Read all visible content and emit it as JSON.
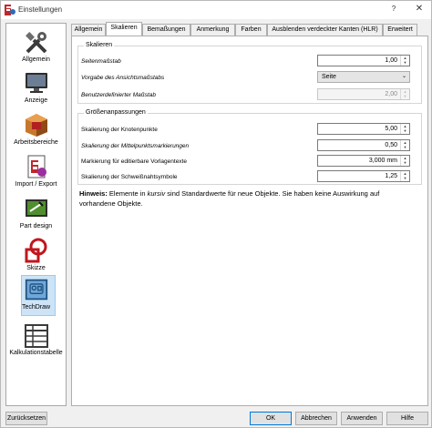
{
  "window": {
    "title": "Einstellungen",
    "help": "?",
    "close": "✕"
  },
  "sidebar": {
    "items": [
      {
        "label": "Allgemein",
        "icon": "tools-icon"
      },
      {
        "label": "Anzeige",
        "icon": "monitor-icon"
      },
      {
        "label": "Arbeitsbereiche",
        "icon": "workbench-icon"
      },
      {
        "label": "Import / Export",
        "icon": "import-export-icon"
      },
      {
        "label": "Part design",
        "icon": "part-design-icon"
      },
      {
        "label": "Skizze",
        "icon": "sketch-icon"
      },
      {
        "label": "TechDraw",
        "icon": "techdraw-icon",
        "selected": true
      },
      {
        "label": "Kalkulationstabelle",
        "icon": "spreadsheet-icon"
      }
    ]
  },
  "tabs": [
    "Allgemein",
    "Skalieren",
    "Bemaßungen",
    "Anmerkung",
    "Farben",
    "Ausblenden verdeckter Kanten (HLR)",
    "Erweitert"
  ],
  "active_tab": "Skalieren",
  "group_skalieren": {
    "title": "Skalieren",
    "page_scale_label": "Seitenmaßstab",
    "page_scale_value": "1,00",
    "view_scale_label": "Vorgabe des Ansichtsmaßstabs",
    "view_scale_value": "Seite",
    "custom_scale_label": "Benutzerdefinierter Maßstab",
    "custom_scale_value": "2,00"
  },
  "group_groessen": {
    "title": "Größenanpassungen",
    "vertex_scale_label": "Skalierung der Knotenpunkte",
    "vertex_scale_value": "5,00",
    "center_mark_label": "Skalierung der Mittelpunktsmarkierungen",
    "center_mark_value": "0,50",
    "template_mark_label": "Markierung für editierbare Vorlagentexte",
    "template_mark_value": "3,000 mm",
    "weld_scale_label": "Skalierung der Schweißnahtsymbole",
    "weld_scale_value": "1,25"
  },
  "hint": {
    "bold": "Hinweis:",
    "before_italic": " Elemente in ",
    "italic": "kursiv",
    "after_italic": " sind Standardwerte für neue Objekte. Sie haben keine Auswirkung auf vorhandene Objekte."
  },
  "buttons": {
    "reset": "Zurücksetzen",
    "ok": "OK",
    "cancel": "Abbrechen",
    "apply": "Anwenden",
    "help": "Hilfe"
  },
  "colors": {
    "accent": "#0078d7",
    "selection": "#cde4f7"
  }
}
